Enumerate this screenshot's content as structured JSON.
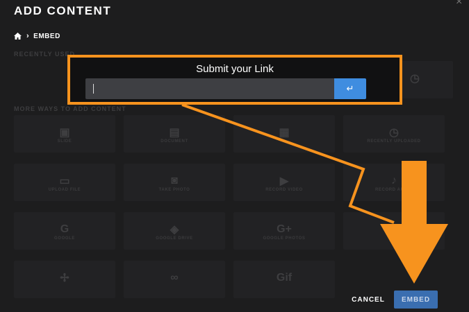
{
  "dialog": {
    "title": "ADD CONTENT",
    "close_glyph": "×"
  },
  "breadcrumb": {
    "home_icon": "home-icon",
    "separator": "›",
    "current": "EMBED"
  },
  "sections": {
    "recent_label": "RECENTLY USED",
    "more_label": "MORE WAYS TO ADD CONTENT"
  },
  "recent_items": [
    {
      "icon": "image-icon",
      "glyph": "▫",
      "label": ""
    },
    {
      "icon": "clock-icon",
      "glyph": "◷",
      "label": ""
    }
  ],
  "more_items": [
    {
      "icon": "slide-icon",
      "glyph": "▣",
      "label": "SLIDE"
    },
    {
      "icon": "document-icon",
      "glyph": "▤",
      "label": "DOCUMENT"
    },
    {
      "icon": "grid-icon",
      "glyph": "▦",
      "label": ""
    },
    {
      "icon": "history-icon",
      "glyph": "◷",
      "label": "RECENTLY UPLOADED"
    },
    {
      "icon": "laptop-icon",
      "glyph": "▭",
      "label": "UPLOAD FILE"
    },
    {
      "icon": "camera-icon",
      "glyph": "◙",
      "label": "TAKE PHOTO"
    },
    {
      "icon": "video-icon",
      "glyph": "▶",
      "label": "RECORD VIDEO"
    },
    {
      "icon": "microphone-icon",
      "glyph": "♪",
      "label": "RECORD AUDIO"
    },
    {
      "icon": "google-icon",
      "glyph": "G",
      "label": "GOOGLE"
    },
    {
      "icon": "google-drive-icon",
      "glyph": "◈",
      "label": "GOOGLE DRIVE"
    },
    {
      "icon": "google-plus-icon",
      "glyph": "G+",
      "label": "GOOGLE PHOTOS"
    },
    {
      "icon": "folder-icon",
      "glyph": "▢",
      "label": ""
    },
    {
      "icon": "pinwheel-icon",
      "glyph": "✢",
      "label": ""
    },
    {
      "icon": "link-icon",
      "glyph": "∞",
      "label": ""
    },
    {
      "icon": "giphy-icon",
      "glyph": "Gif",
      "label": ""
    }
  ],
  "submit": {
    "title": "Submit your Link",
    "input_value": "",
    "input_placeholder": "",
    "enter_glyph": "↵"
  },
  "footer": {
    "cancel_label": "CANCEL",
    "embed_label": "EMBED"
  },
  "colors": {
    "highlight": "#f7931e",
    "accent": "#3f8de0",
    "background": "#1d1d1e"
  }
}
